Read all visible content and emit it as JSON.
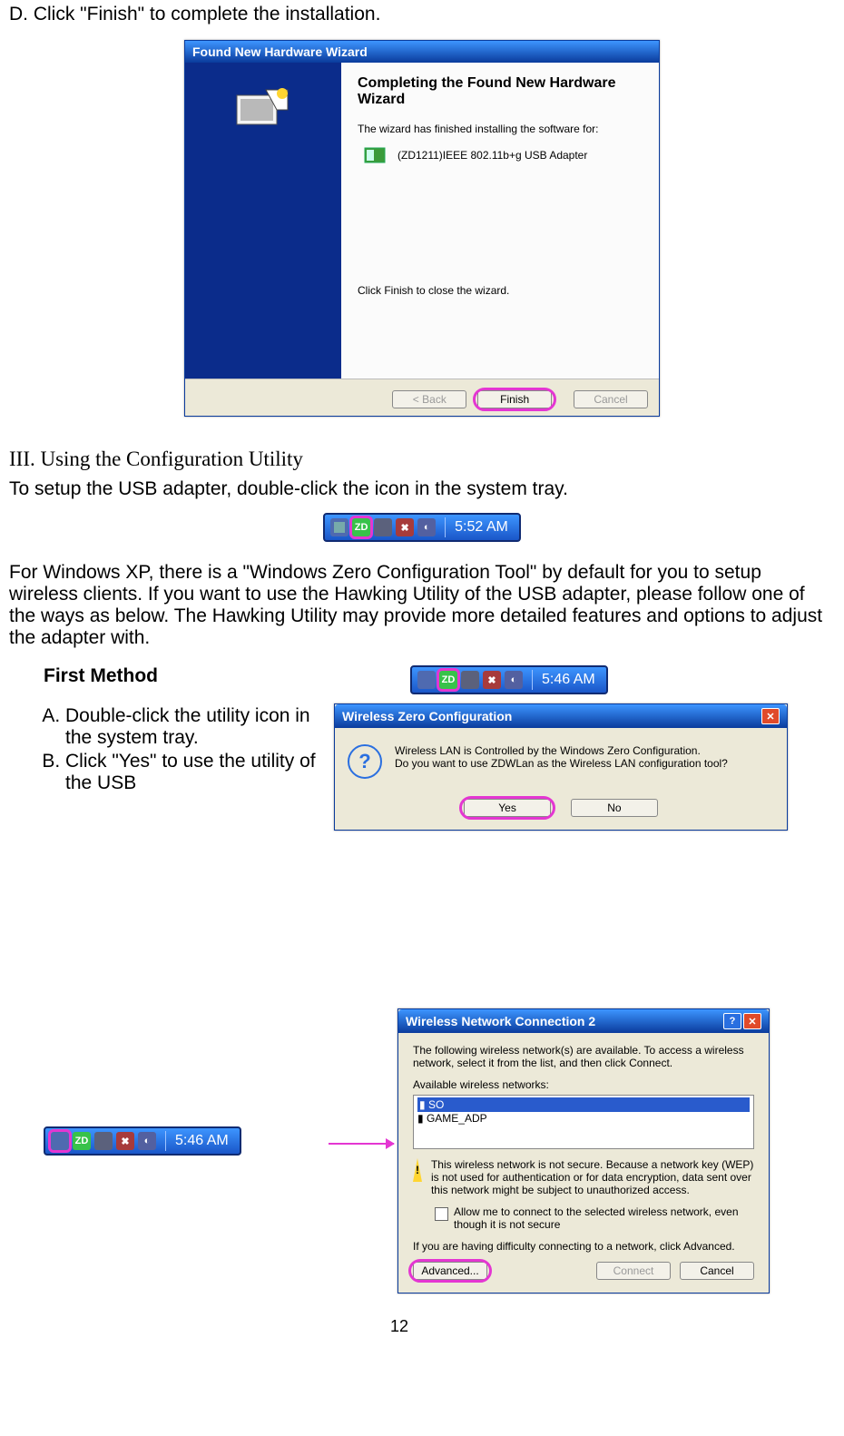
{
  "step_d": "D. Click \"Finish\" to complete the installation.",
  "wizard": {
    "titlebar": "Found New Hardware Wizard",
    "heading": "Completing the Found New Hardware Wizard",
    "subtext": "The wizard has finished installing the software for:",
    "device": "(ZD1211)IEEE 802.11b+g USB Adapter",
    "closing": "Click Finish to close the wizard.",
    "btn_back": "< Back",
    "btn_finish": "Finish",
    "btn_cancel": "Cancel"
  },
  "section3": "III. Using the Configuration Utility",
  "setup_line": "To setup the USB adapter, double-click the icon in the system tray.",
  "tray_times": {
    "t1": "5:52 AM",
    "t2": "5:46 AM",
    "t3": "5:46 AM"
  },
  "xp_para": "For Windows XP, there is a \"Windows Zero Configuration Tool\" by default for you to setup wireless clients. If you want to use the Hawking Utility of the USB adapter, please follow one of the ways as below.   The Hawking Utility may provide more detailed features and options to adjust the adapter with.",
  "first_method": {
    "title": "First Method",
    "a": "Double-click the utility icon in the system tray.",
    "b": "Click \"Yes\" to use the utility of the USB"
  },
  "wzc": {
    "title": "Wireless Zero Configuration",
    "line1": "Wireless LAN is Controlled by the Windows Zero Configuration.",
    "line2": "Do you want to use ZDWLan as the Wireless LAN configuration tool?",
    "yes": "Yes",
    "no": "No"
  },
  "wnc": {
    "title": "Wireless Network Connection 2",
    "intro": "The following wireless network(s) are available. To access a wireless network, select it from the list, and then click Connect.",
    "avail_label": "Available wireless networks:",
    "nets": [
      "SO",
      "GAME_ADP"
    ],
    "warn": "This wireless network is not secure. Because a network key (WEP) is not used for authentication or for data encryption, data sent over this network might be subject to unauthorized access.",
    "allow": "Allow me to connect to the selected wireless network, even though it is not secure",
    "adv_hint": "If you are having difficulty connecting to a network, click Advanced.",
    "advanced": "Advanced...",
    "connect": "Connect",
    "cancel": "Cancel"
  },
  "page_no": "12"
}
